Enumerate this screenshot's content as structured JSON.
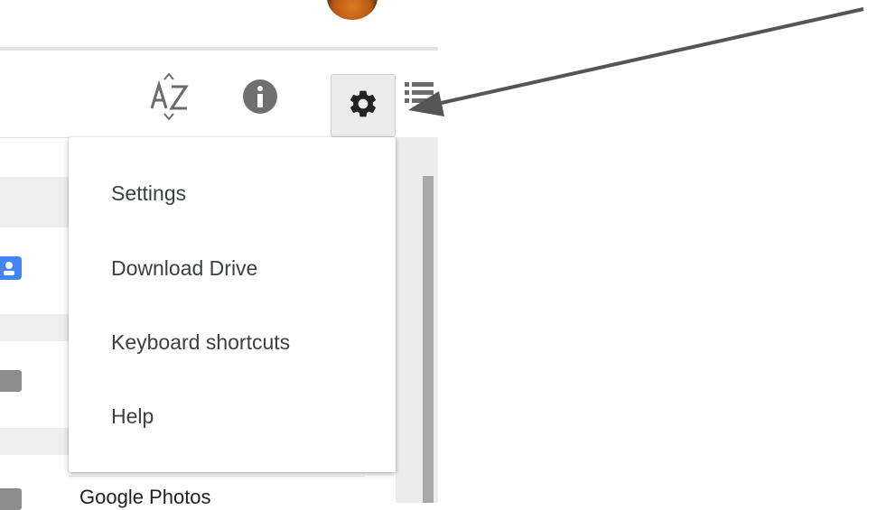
{
  "toolbar": {
    "icons": {
      "list": "list-view-icon",
      "sort": "sort-a-z-icon",
      "info": "info-icon",
      "settings": "gear-icon"
    }
  },
  "settings_menu": {
    "items": [
      {
        "label": "Settings"
      },
      {
        "label": "Download Drive"
      },
      {
        "label": "Keyboard shortcuts"
      },
      {
        "label": "Help"
      }
    ]
  },
  "sidebar": {
    "visible_item": "Google Photos"
  },
  "annotation": {
    "arrow_color": "#555555"
  },
  "colors": {
    "menu_text": "#3c4043",
    "icon_dark": "#222222",
    "icon_grey": "#6b6b6b",
    "accent_blue": "#4285f4"
  }
}
